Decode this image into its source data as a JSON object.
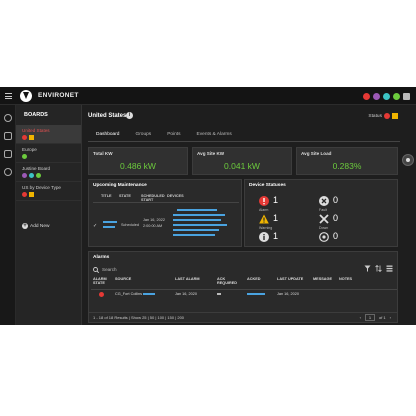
{
  "app": {
    "brand": "ENVIRONET"
  },
  "colors": {
    "ok": "#6ccb3d",
    "alarm": "#e53935",
    "warning": "#f0b400",
    "link": "#4aa3e0",
    "accent_purple": "#9b59b6"
  },
  "boards": {
    "heading": "BOARDS",
    "items": [
      {
        "label": "United States",
        "active": true
      },
      {
        "label": "Europe"
      },
      {
        "label": "Justine Board"
      },
      {
        "label": "US by Device Type"
      }
    ],
    "add_new": "Add New"
  },
  "header": {
    "title": "United States",
    "status_label": "Status"
  },
  "tabs": [
    "Dashboard",
    "Groups",
    "Points",
    "Events & Alarms"
  ],
  "kpis": [
    {
      "title": "Total KW",
      "value": "0.486 kW"
    },
    {
      "title": "Avg Site KW",
      "value": "0.041 kW"
    },
    {
      "title": "Avg Site Load",
      "value": "0.283%"
    }
  ],
  "maintenance": {
    "title": "Upcoming Maintenance",
    "columns": [
      "TITLE",
      "STATE",
      "SCHEDULED START",
      "DEVICES"
    ],
    "row": {
      "state": "Scheduled",
      "date": "Jan 16, 2022",
      "time": "2:00:00 AM"
    }
  },
  "device_statuses": {
    "title": "Device Statuses",
    "cells": [
      {
        "label": "Alarm",
        "count": "1"
      },
      {
        "label": "Fault",
        "count": "0"
      },
      {
        "label": "Warning",
        "count": "1"
      },
      {
        "label": "Down",
        "count": "0"
      },
      {
        "label": "",
        "count": "1"
      },
      {
        "label": "",
        "count": "0"
      }
    ]
  },
  "alarms": {
    "title": "Alarms",
    "search_placeholder": "Search",
    "columns": [
      "ALARM STATE",
      "SOURCE",
      "LAST ALARM",
      "ACK REQUIRED",
      "ACKED",
      "LAST UPDATE",
      "MESSAGE",
      "NOTES"
    ],
    "row": {
      "source": "CG_Fort Collins",
      "last_alarm": "Jan 16, 2020",
      "last_update": "Jan 16, 2020"
    },
    "footer": "1 - 18 of 18 Results | Show 25 | 50 | 100 | 150 | 200",
    "page_of": "of 1",
    "page_value": "1"
  }
}
